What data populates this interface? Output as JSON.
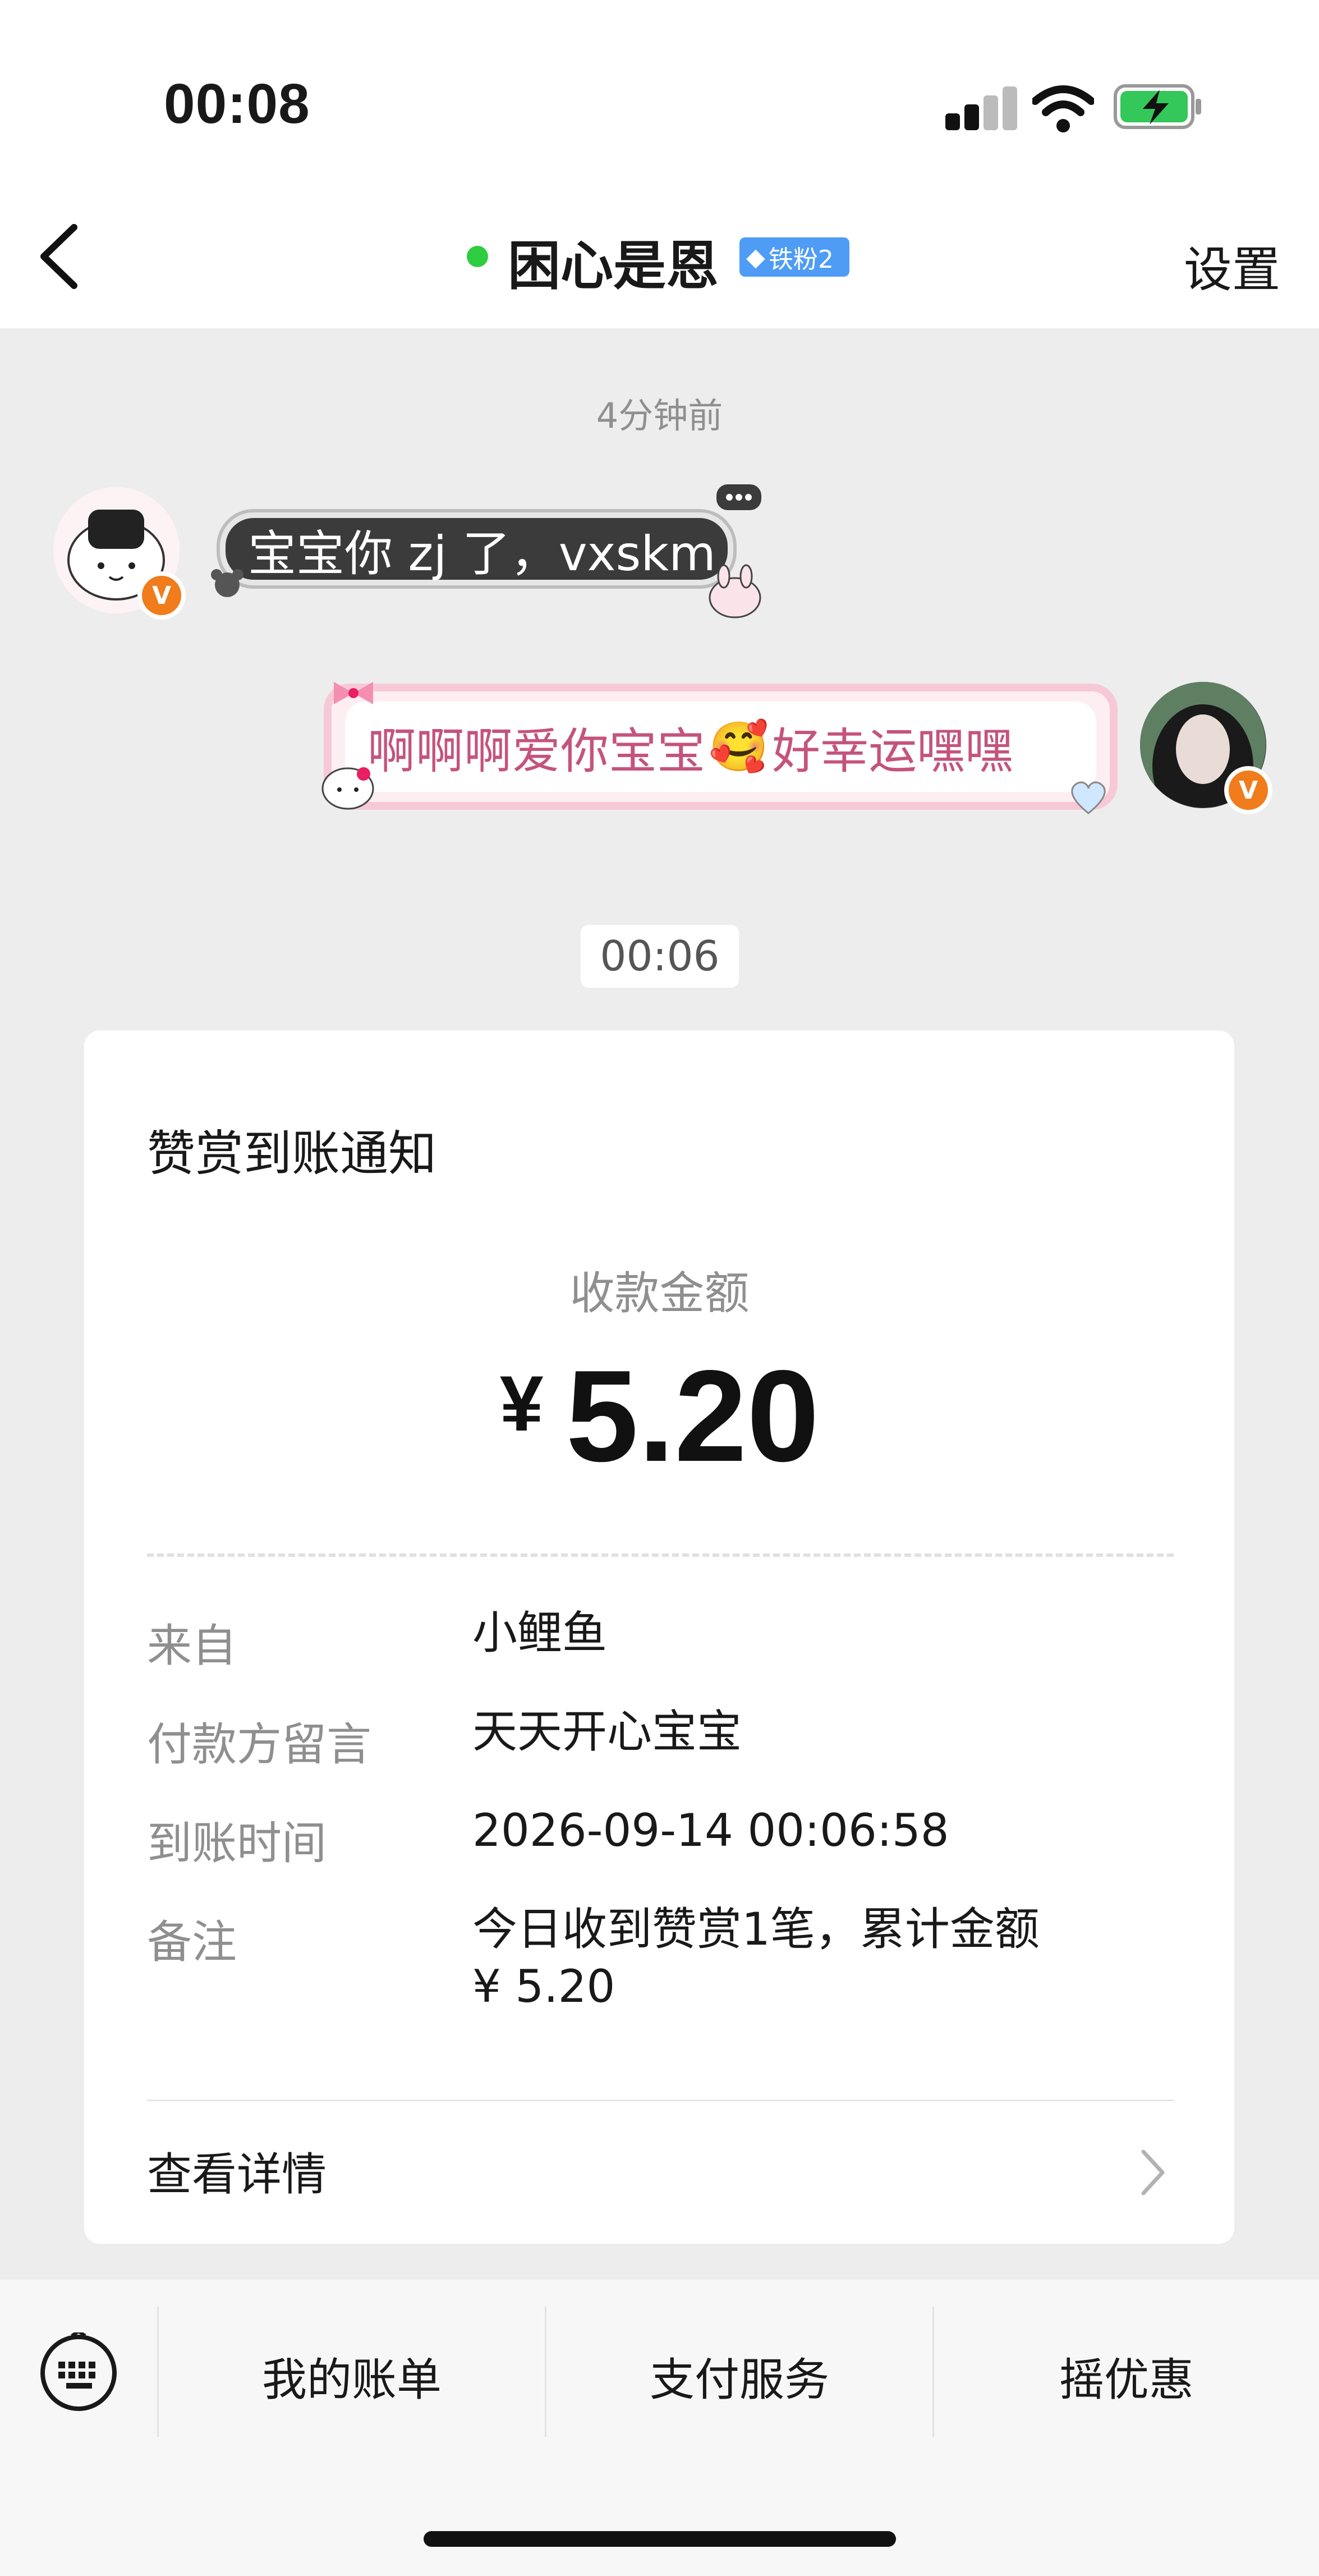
{
  "status_bar": {
    "time": "00:08"
  },
  "header": {
    "chat_name": "困心是恩",
    "fan_badge": "铁粉2",
    "settings_label": "设置"
  },
  "chat": {
    "timestamp_top": "4分钟前",
    "messages": [
      {
        "side": "left",
        "text": "宝宝你 zj 了，vxskm"
      },
      {
        "side": "right",
        "text": "啊啊啊爱你宝宝",
        "emoji": "🥰",
        "text_after": "好幸运嘿嘿"
      }
    ],
    "timestamp_mid": "00:06",
    "verified_badge": "V"
  },
  "card": {
    "title": "赞赏到账通知",
    "amount_label": "收款金额",
    "currency": "¥",
    "amount": "5.20",
    "rows": [
      {
        "label": "来自",
        "value": "小鲤鱼"
      },
      {
        "label": "付款方留言",
        "value": "天天开心宝宝"
      },
      {
        "label": "到账时间",
        "value": "2026-09-14 00:06:58"
      },
      {
        "label": "备注",
        "value": "今日收到赞赏1笔，累计金额",
        "value2": "¥ 5.20"
      }
    ],
    "details_label": "查看详情"
  },
  "bottom_menu": {
    "items": [
      "我的账单",
      "支付服务",
      "摇优惠"
    ]
  },
  "colors": {
    "online": "#2ecc40",
    "badge": "#4e9cf5",
    "verified": "#f07c1b",
    "pink_text": "#c4537d"
  }
}
